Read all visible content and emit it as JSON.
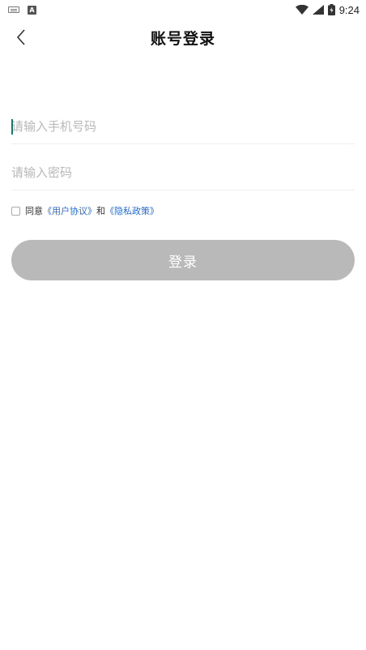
{
  "status_bar": {
    "time": "9:24",
    "notification_icon_letter": "A"
  },
  "header": {
    "title": "账号登录"
  },
  "form": {
    "phone_placeholder": "请输入手机号码",
    "password_placeholder": "请输入密码"
  },
  "agreement": {
    "prefix": "同意",
    "user_agreement": "《用户协议》",
    "conjunction": "和",
    "privacy_policy": "《隐私政策》"
  },
  "login_button": {
    "label": "登录"
  },
  "colors": {
    "button_disabled": "#b9b9b9",
    "link": "#2a6ad4",
    "caret": "#0d7d74"
  }
}
